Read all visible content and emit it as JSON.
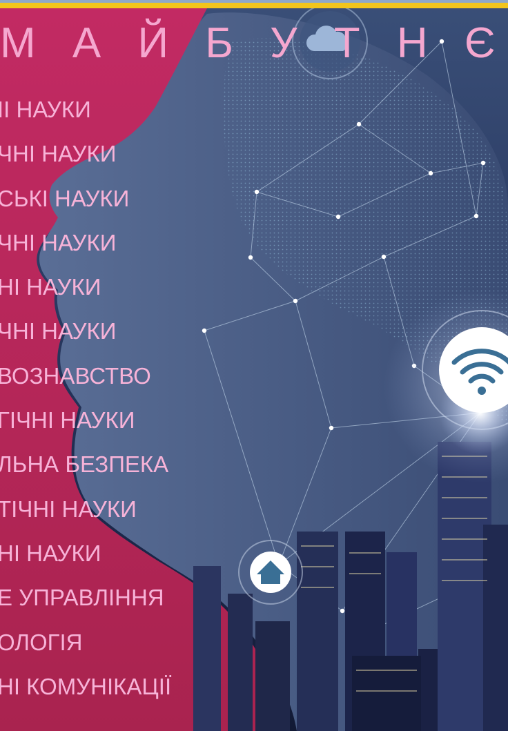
{
  "title": "М А Й Б У Т Н Є",
  "subjects": [
    "ІІ НАУКИ",
    "ЧНІ НАУКИ",
    "СЬКІ НАУКИ",
    "ЧНІ НАУКИ",
    "НІ НАУКИ",
    "ЧНІ НАУКИ",
    "ВОЗНАВСТВО",
    "ГІЧНІ НАУКИ",
    "ЛЬНА БЕЗПЕКА",
    "ТІЧНІ НАУКИ",
    "НІ НАУКИ",
    "Е УПРАВЛІННЯ",
    "ОЛОГІЯ",
    "НІ КОМУНІКАЦІЇ"
  ],
  "colors": {
    "accent_stripe": "#f2c51c",
    "magenta_panel": "#b8285a",
    "title_text": "#f5a7cf",
    "subject_text": "#f7b3d8"
  },
  "icons": [
    "cloud-icon",
    "wifi-icon",
    "home-icon"
  ]
}
